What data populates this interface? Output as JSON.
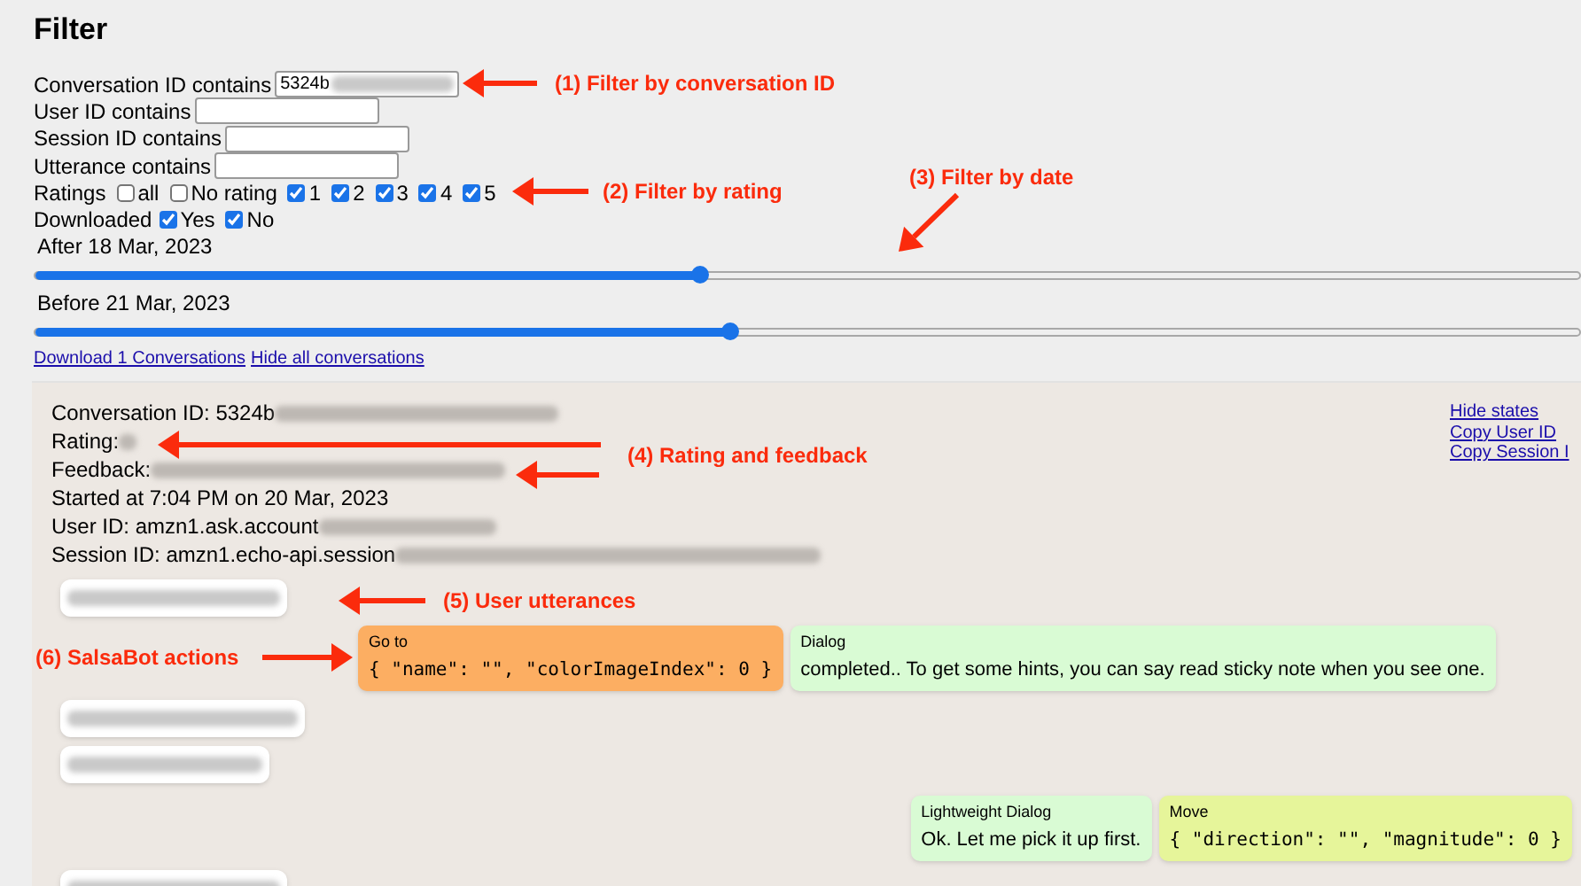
{
  "title": "Filter",
  "text_filters": [
    {
      "label": "Conversation ID contains",
      "value": "5324b",
      "redacted": true
    },
    {
      "label": "User ID contains",
      "redacted": false
    },
    {
      "label": "Session ID contains",
      "redacted": false
    },
    {
      "label": "Utterance contains",
      "redacted": false
    }
  ],
  "ratings": {
    "label": "Ratings",
    "options": [
      {
        "label": "all",
        "checked": false
      },
      {
        "label": "No rating",
        "checked": false
      },
      {
        "label": "1",
        "checked": true
      },
      {
        "label": "2",
        "checked": true
      },
      {
        "label": "3",
        "checked": true
      },
      {
        "label": "4",
        "checked": true
      },
      {
        "label": "5",
        "checked": true
      }
    ]
  },
  "downloaded": {
    "label": "Downloaded",
    "options": [
      {
        "label": "Yes",
        "checked": true
      },
      {
        "label": "No",
        "checked": true
      }
    ]
  },
  "date_sliders": [
    {
      "label": "After 18 Mar, 2023",
      "level": 0.43
    },
    {
      "label": "Before 21 Mar, 2023",
      "level": 0.45
    }
  ],
  "links": [
    "Download 1 Conversations",
    "Hide all conversations"
  ],
  "conversation": {
    "info": [
      {
        "label": "Conversation ID: 5324b",
        "redacted": true
      },
      {
        "label": "Rating:",
        "redacted": true
      },
      {
        "label": "Feedback:",
        "redacted": true
      },
      {
        "label": "Started at 7:04 PM on 20 Mar, 2023",
        "redacted": false
      },
      {
        "label": "User ID: amzn1.ask.account",
        "redacted": true
      },
      {
        "label": "Session ID: amzn1.echo-api.session",
        "redacted": true
      }
    ],
    "links": [
      "Hide states",
      "Copy User ID",
      "Copy Session I"
    ],
    "rows": [
      {
        "kind": "user",
        "messages": [
          {
            "kind": "user"
          }
        ]
      },
      {
        "kind": "bot",
        "messages": [
          {
            "kind": "goto",
            "title": "Go to",
            "body": "{ \"name\": \"\", \"colorImageIndex\": 0 }"
          },
          {
            "kind": "dialog",
            "title": "Dialog",
            "body": "completed.. To get some hints, you can say read sticky note when you see one."
          }
        ]
      },
      {
        "kind": "user",
        "messages": [
          {
            "kind": "user"
          }
        ]
      },
      {
        "kind": "user",
        "messages": [
          {
            "kind": "user"
          }
        ]
      },
      {
        "kind": "bot-right",
        "messages": [
          {
            "kind": "dialog",
            "title": "Lightweight Dialog",
            "body": "Ok. Let me pick it up first."
          },
          {
            "kind": "move",
            "title": "Move",
            "body": "{ \"direction\": \"\", \"magnitude\": 0 }"
          }
        ]
      },
      {
        "kind": "user",
        "messages": [
          {
            "kind": "user"
          }
        ]
      }
    ]
  },
  "annotations": [
    {
      "label": "(1) Filter by conversation ID"
    },
    {
      "label": "(2) Filter by rating"
    },
    {
      "label": "(3) Filter by date"
    },
    {
      "label": "(4) Rating and feedback"
    },
    {
      "label": "(5) User utterances"
    },
    {
      "label": "(6) SalsaBot actions"
    }
  ]
}
